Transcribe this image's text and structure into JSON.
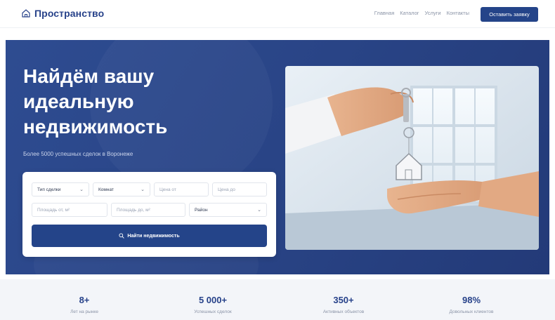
{
  "header": {
    "logo_text": "Пространство",
    "logo_icon": "house-icon",
    "nav": [
      "Главная",
      "Каталог",
      "Услуги",
      "Контакты"
    ],
    "cta_label": "Оставить заявку"
  },
  "hero": {
    "title": "Найдём вашу идеальную недвижимость",
    "subtitle": "Более 5000 успешных сделок в Воронеже"
  },
  "search": {
    "deal_type": "Тип сделки",
    "rooms": "Комнат",
    "price_from": "Цена от",
    "price_to": "Цена до",
    "area_from": "Площадь от, м²",
    "area_to": "Площадь до, м²",
    "district": "Район",
    "button_label": "Найти недвижимость"
  },
  "stats": [
    {
      "value": "8+",
      "label": "Лет на рынке"
    },
    {
      "value": "5 000+",
      "label": "Успешных сделок"
    },
    {
      "value": "350+",
      "label": "Активных объектов"
    },
    {
      "value": "98%",
      "label": "Довольных клиентов"
    }
  ],
  "colors": {
    "brand": "#244489",
    "hero_bg": "#2e4c91",
    "stats_bg": "#f3f5f9"
  }
}
